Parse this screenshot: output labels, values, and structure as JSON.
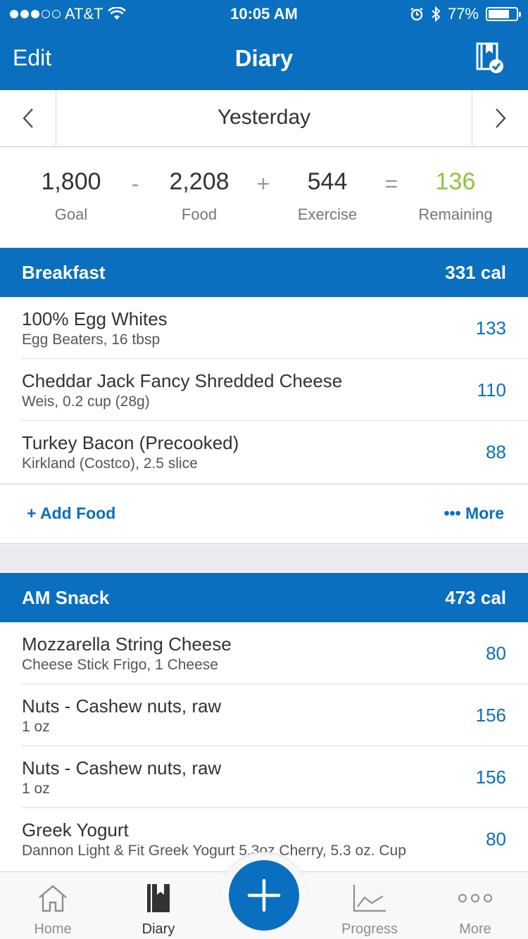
{
  "status_bar": {
    "carrier": "AT&T",
    "time": "10:05 AM",
    "battery": "77%",
    "battery_level": 0.77
  },
  "nav": {
    "edit_label": "Edit",
    "title": "Diary"
  },
  "date": {
    "label": "Yesterday"
  },
  "summary": {
    "goal_value": "1,800",
    "goal_label": "Goal",
    "food_value": "2,208",
    "food_label": "Food",
    "exercise_value": "544",
    "exercise_label": "Exercise",
    "remaining_value": "136",
    "remaining_label": "Remaining",
    "op_minus": "-",
    "op_plus": "+",
    "op_equals": "=",
    "remaining_color": "#8dc63f"
  },
  "breakfast": {
    "name": "Breakfast",
    "calories": "331 cal",
    "items": [
      {
        "name": "100% Egg Whites",
        "detail": "Egg Beaters, 16 tbsp",
        "calories": "133"
      },
      {
        "name": "Cheddar Jack Fancy Shredded Cheese",
        "detail": "Weis, 0.2 cup (28g)",
        "calories": "110"
      },
      {
        "name": "Turkey Bacon (Precooked)",
        "detail": "Kirkland (Costco), 2.5 slice",
        "calories": "88"
      }
    ],
    "add_food_label": "Add Food",
    "more_label": "More"
  },
  "am_snack": {
    "name": "AM Snack",
    "calories": "473 cal",
    "items": [
      {
        "name": "Mozzarella String Cheese",
        "detail": "Cheese Stick Frigo, 1 Cheese",
        "calories": "80"
      },
      {
        "name": "Nuts - Cashew nuts, raw",
        "detail": "1 oz",
        "calories": "156"
      },
      {
        "name": "Nuts - Cashew nuts, raw",
        "detail": "1 oz",
        "calories": "156"
      },
      {
        "name": "Greek Yogurt",
        "detail": "Dannon Light & Fit Greek Yogurt 5.3oz Cherry, 5.3 oz. Cup",
        "calories": "80"
      }
    ]
  },
  "tabbar": {
    "home": "Home",
    "diary": "Diary",
    "progress": "Progress",
    "more": "More"
  },
  "colors": {
    "brand_blue": "#0a6fbf",
    "remaining_green": "#8dc63f"
  },
  "icons": {
    "nav_right": "diary-check-icon",
    "fab": "plus-icon"
  }
}
